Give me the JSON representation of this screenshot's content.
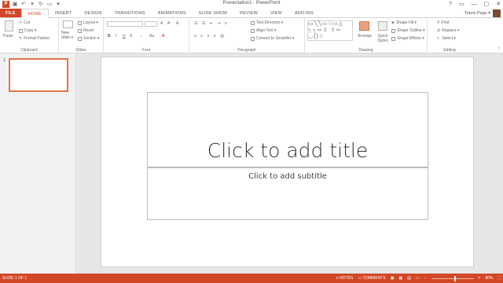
{
  "window": {
    "title": "Presentation1 - PowerPoint",
    "help": "?",
    "controls": [
      "▭",
      "—",
      "▢",
      "✕"
    ]
  },
  "tabs": [
    "FILE",
    "HOME",
    "INSERT",
    "DESIGN",
    "TRANSITIONS",
    "ANIMATIONS",
    "SLIDE SHOW",
    "REVIEW",
    "VIEW",
    "ADD-INS"
  ],
  "active_tab": "HOME",
  "user": {
    "name": "Travis Page ▾"
  },
  "ribbon": {
    "clipboard": {
      "paste": "Paste",
      "cut": "Cut",
      "copy": "Copy ▾",
      "format_painter": "Format Painter",
      "label": "Clipboard"
    },
    "slides": {
      "new_slide": "New Slide ▾",
      "layout": "Layout ▾",
      "reset": "Reset",
      "section": "Section ▾",
      "label": "Slides"
    },
    "font": {
      "label": "Font",
      "bold": "B",
      "italic": "I",
      "underline": "U",
      "strike": "S",
      "grow": "A",
      "shrink": "A",
      "clear": "A"
    },
    "paragraph": {
      "text_direction": "Text Direction ▾",
      "align_text": "Align Text ▾",
      "smartart": "Convert to SmartArt ▾",
      "label": "Paragraph"
    },
    "drawing": {
      "arrange": "Arrange",
      "quick_styles": "Quick Styles",
      "shape_fill": "Shape Fill ▾",
      "shape_outline": "Shape Outline ▾",
      "shape_effects": "Shape Effects ▾",
      "label": "Drawing"
    },
    "editing": {
      "find": "Find",
      "replace": "Replace ▾",
      "select": "Select ▾",
      "label": "Editing"
    }
  },
  "thumbnails": [
    {
      "number": "1"
    }
  ],
  "slide": {
    "title_placeholder": "Click to add title",
    "subtitle_placeholder": "Click to add subtitle"
  },
  "status": {
    "slide_info": "SLIDE 1 OF 1",
    "notes": "NOTES",
    "comments": "COMMENTS",
    "zoom": "80%",
    "zoom_fraction": 0.55
  },
  "colors": {
    "accent": "#d24726"
  }
}
